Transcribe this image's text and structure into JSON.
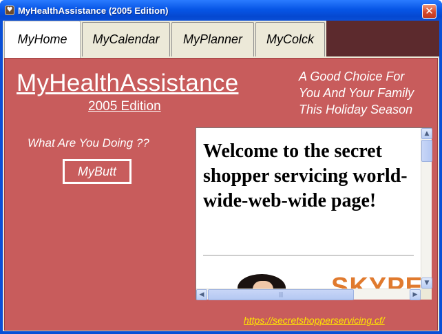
{
  "window": {
    "title": "MyHealthAssistance (2005 Edition)",
    "close_glyph": "✕",
    "icon": "app-icon"
  },
  "tabs": [
    {
      "label": "MyHome",
      "active": true
    },
    {
      "label": "MyCalendar",
      "active": false
    },
    {
      "label": "MyPlanner",
      "active": false
    },
    {
      "label": "MyColck",
      "active": false
    }
  ],
  "home": {
    "app_title": "MyHealthAssistance",
    "edition": "2005 Edition",
    "tagline": [
      "A Good Choice For",
      "You And Your Family",
      "This Holiday Season"
    ],
    "question": "What Are You Doing ??",
    "button_label": "MyButt",
    "link_text": "https://secretshopperservicing.cf/"
  },
  "browser": {
    "heading": "Welcome to the secret shopper servicing world-wide-web-wide page!",
    "ad_text": "SKYPE"
  },
  "colors": {
    "panel_bg": "#c85c5c",
    "link": "#ffe600",
    "titlebar": "#0a4fd6",
    "tab_filler": "#5c2a2d"
  }
}
